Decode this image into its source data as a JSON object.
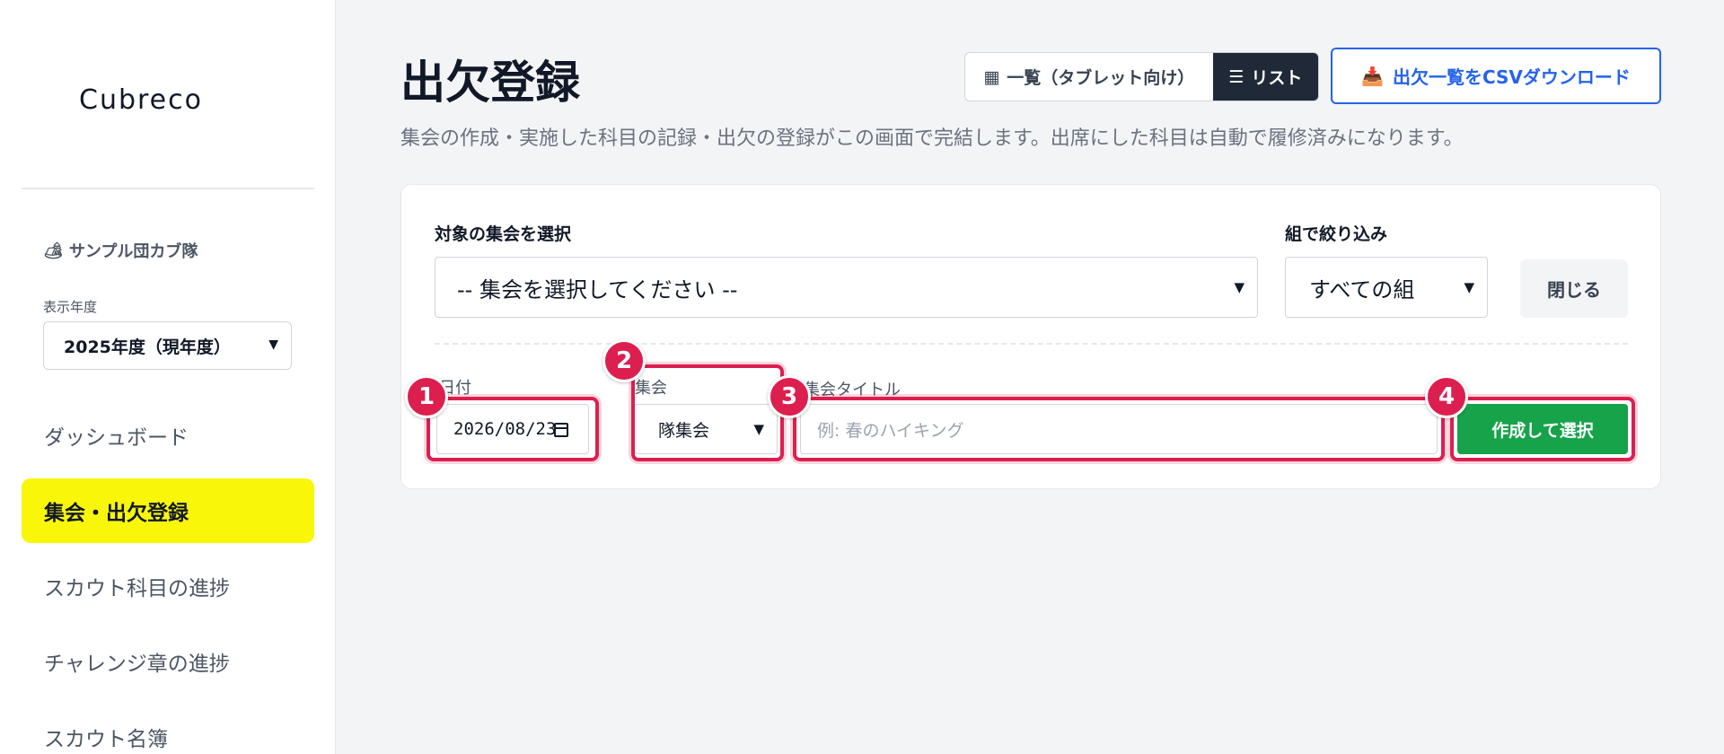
{
  "sidebar": {
    "logo": "Cubreco",
    "troop_icon": "🏕",
    "troop_name": "サンプル団カブ隊",
    "year_label": "表示年度",
    "year_value": "2025年度（現年度）",
    "items": [
      {
        "label": "ダッシュボード",
        "active": false
      },
      {
        "label": "集会・出欠登録",
        "active": true
      },
      {
        "label": "スカウト科目の進捗",
        "active": false
      },
      {
        "label": "チャレンジ章の進捗",
        "active": false
      },
      {
        "label": "スカウト名簿",
        "active": false
      }
    ]
  },
  "header": {
    "title": "出欠登録",
    "description": "集会の作成・実施した科目の記録・出欠の登録がこの画面で完結します。出席にした科目は自動で履修済みになります。",
    "view_grid_icon": "▦",
    "view_grid_label": "一覧（タブレット向け）",
    "view_list_icon": "☰",
    "view_list_label": "リスト",
    "csv_icon": "📥",
    "csv_label": "出欠一覧をCSVダウンロード"
  },
  "form": {
    "meeting_select_label": "対象の集会を選択",
    "meeting_select_value": "-- 集会を選択してください --",
    "group_filter_label": "組で絞り込み",
    "group_filter_value": "すべての組",
    "close_label": "閉じる",
    "date_label": "日付",
    "date_value": "2026/08/23",
    "type_label": "集会",
    "type_value": "隊集会",
    "title_label": "集会タイトル",
    "title_placeholder": "例: 春のハイキング",
    "create_label": "作成して選択"
  },
  "annotations": [
    "1",
    "2",
    "3",
    "4"
  ],
  "colors": {
    "accent_yellow": "#faf60a",
    "primary_blue": "#2563eb",
    "success_green": "#16a34a",
    "highlight_red": "#dc1f4f"
  }
}
